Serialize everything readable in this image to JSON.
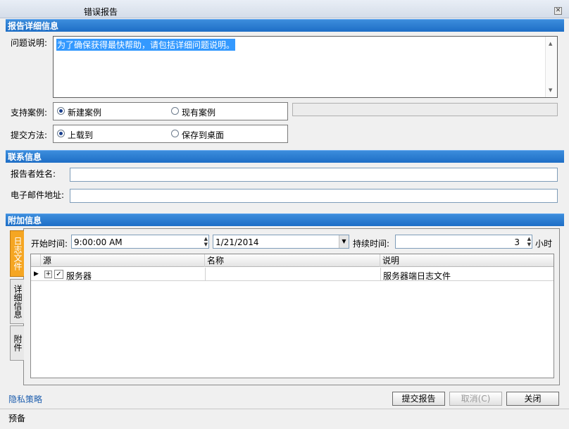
{
  "window": {
    "title": "错误报告",
    "close_glyph": "✕"
  },
  "report_section": {
    "header": "报告详细信息",
    "description_label": "问题说明:",
    "description_value": "为了确保获得最快帮助，请包括详细问题说明。",
    "support_case_label": "支持案例:",
    "support_case_options": [
      "新建案例",
      "现有案例"
    ],
    "support_case_selected": "新建案例",
    "submit_method_label": "提交方法:",
    "submit_method_options": [
      "上载到",
      "保存到桌面"
    ],
    "submit_method_selected": "上载到"
  },
  "contact_section": {
    "header": "联系信息",
    "reporter_name_label": "报告者姓名:",
    "reporter_name_value": "",
    "email_label": "电子邮件地址:",
    "email_value": ""
  },
  "attachments_section": {
    "header": "附加信息",
    "tabs": [
      "日志文件",
      "详细信息",
      "附件"
    ],
    "active_tab": "日志文件",
    "start_time_label": "开始时间:",
    "start_time_value": "9:00:00 AM",
    "start_date_value": "1/21/2014",
    "duration_label": "持续时间:",
    "duration_value": "3",
    "duration_unit": "小时",
    "grid": {
      "columns": [
        "源",
        "名称",
        "说明"
      ],
      "rows": [
        {
          "source": "服务器",
          "name": "",
          "description": "服务器端日志文件",
          "checked": true
        }
      ]
    }
  },
  "footer": {
    "privacy_link": "隐私策略",
    "submit_button": "提交报告",
    "cancel_button": "取消(C)",
    "close_button": "关闭",
    "status_text": "预备"
  },
  "colors": {
    "section_header": "#1e6ec6",
    "link": "#1f5fae",
    "active_tab": "#f5a623",
    "selection": "#3399ff"
  },
  "icons": [
    "close-icon",
    "scroll-up-arrow-icon",
    "scroll-down-arrow-icon",
    "spin-up-icon",
    "spin-down-icon",
    "dropdown-arrow-icon",
    "row-indicator-icon",
    "expand-plus-icon",
    "checkbox-icon"
  ]
}
